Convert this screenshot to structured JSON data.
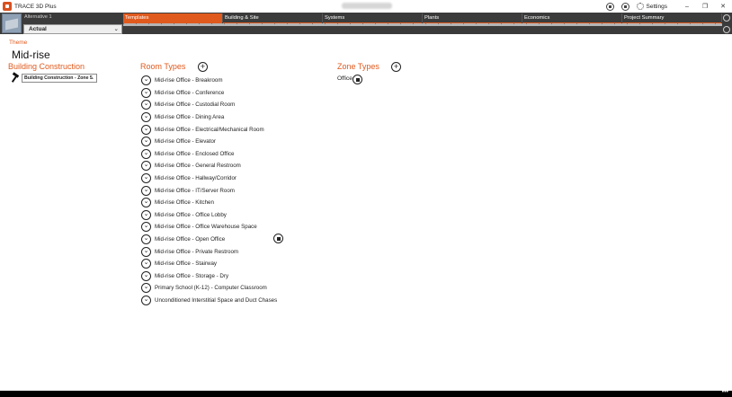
{
  "window": {
    "title": "TRACE 3D Plus",
    "settings_label": "Settings",
    "minimize": "–",
    "restore": "❐",
    "close": "✕"
  },
  "ribbon": {
    "alternative_label": "Alternative 1",
    "alternative_select": "Actual",
    "tabs": [
      "Templates",
      "Building & Site",
      "Systems",
      "Plants",
      "Economics",
      "Project Summary"
    ],
    "active_tab": "Templates"
  },
  "content": {
    "theme_link": "Theme",
    "page_title": "Mid-rise",
    "building_construction": {
      "heading": "Building Construction",
      "selected": "Building Construction - Zone 5"
    },
    "room_types": {
      "heading": "Room Types",
      "items": [
        "Mid-rise Office - Breakroom",
        "Mid-rise Office - Conference",
        "Mid-rise Office - Custodial Room",
        "Mid-rise Office - Dining Area",
        "Mid-rise Office - Electrical/Mechanical Room",
        "Mid-rise Office - Elevator",
        "Mid-rise Office - Enclosed Office",
        "Mid-rise Office - General Restroom",
        "Mid-rise Office - Hallway/Corridor",
        "Mid-rise Office - IT/Server Room",
        "Mid-rise Office - Kitchen",
        "Mid-rise Office - Office Lobby",
        "Mid-rise Office - Office Warehouse Space",
        "Mid-rise Office - Open Office",
        "Mid-rise Office - Private Restroom",
        "Mid-rise Office - Stairway",
        "Mid-rise Office - Storage - Dry",
        "Primary School (K-12) - Computer Classroom",
        "Unconditioned Interstitial Space and Duct Chases"
      ]
    },
    "zone_types": {
      "heading": "Zone Types",
      "items": [
        "Office"
      ]
    }
  },
  "colors": {
    "accent": "#e05a1e",
    "ribbon": "#3b3b3b"
  }
}
